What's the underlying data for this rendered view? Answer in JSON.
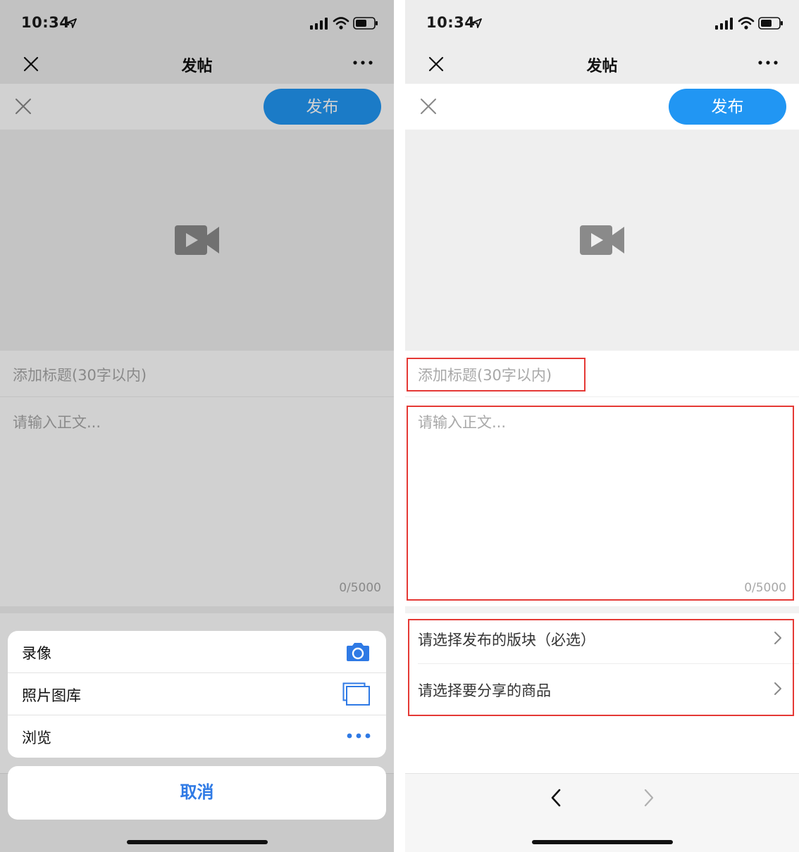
{
  "status_bar": {
    "time": "10:34"
  },
  "nav": {
    "title": "发帖"
  },
  "toolbar": {
    "publish_label": "发布"
  },
  "form": {
    "title_placeholder": "添加标题(30字以内)",
    "body_placeholder": "请输入正文...",
    "char_count": "0/5000",
    "select_board": "请选择发布的版块（必选）",
    "select_product": "请选择要分享的商品"
  },
  "action_sheet": {
    "items": [
      {
        "label": "录像",
        "icon": "camera-icon"
      },
      {
        "label": "照片图库",
        "icon": "photo-library-icon"
      },
      {
        "label": "浏览",
        "icon": "more-icon"
      }
    ],
    "cancel_label": "取消"
  },
  "colors": {
    "accent": "#2196f3",
    "annotation": "#e53935",
    "action_blue": "#2f7ae5"
  }
}
